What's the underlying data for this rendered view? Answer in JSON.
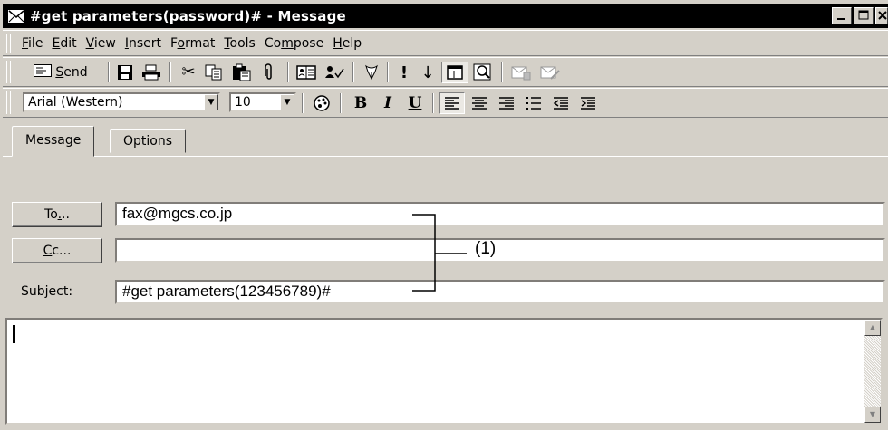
{
  "window": {
    "title": "#get parameters(password)# - Message",
    "controls": {
      "minimize": "_",
      "maximize": "□",
      "close": "×"
    }
  },
  "menubar": {
    "items": [
      {
        "pre": "",
        "u": "F",
        "post": "ile"
      },
      {
        "pre": "",
        "u": "E",
        "post": "dit"
      },
      {
        "pre": "",
        "u": "V",
        "post": "iew"
      },
      {
        "pre": "",
        "u": "I",
        "post": "nsert"
      },
      {
        "pre": "F",
        "u": "o",
        "post": "rmat"
      },
      {
        "pre": "",
        "u": "T",
        "post": "ools"
      },
      {
        "pre": "Co",
        "u": "m",
        "post": "pose"
      },
      {
        "pre": "",
        "u": "H",
        "post": "elp"
      }
    ]
  },
  "toolbar": {
    "send_pre": "",
    "send_u": "S",
    "send_post": "end",
    "icons": [
      "save-icon",
      "print-icon",
      "cut-icon",
      "copy-icon",
      "paste-icon",
      "attach-icon",
      "address-book-icon",
      "check-names-icon",
      "flag-icon",
      "high-importance-icon",
      "low-importance-icon",
      "properties-icon",
      "help-icon",
      "sign-icon",
      "encrypt-icon"
    ]
  },
  "format": {
    "font": "Arial (Western)",
    "size": "10",
    "bold": "B",
    "italic": "I",
    "underline": "U"
  },
  "tabs": [
    {
      "label": "Message",
      "active": true
    },
    {
      "label": "Options",
      "active": false
    }
  ],
  "fields": {
    "to_button": {
      "pre": "To",
      "u": ".",
      "post": ".."
    },
    "cc_button": {
      "pre": "",
      "u": "C",
      "post": "c..."
    },
    "subject_label": "Subject:",
    "to_value": "fax@mgcs.co.jp",
    "cc_value": "",
    "subject_value": "#get parameters(123456789)#"
  },
  "annotation": {
    "label": "(1)"
  }
}
